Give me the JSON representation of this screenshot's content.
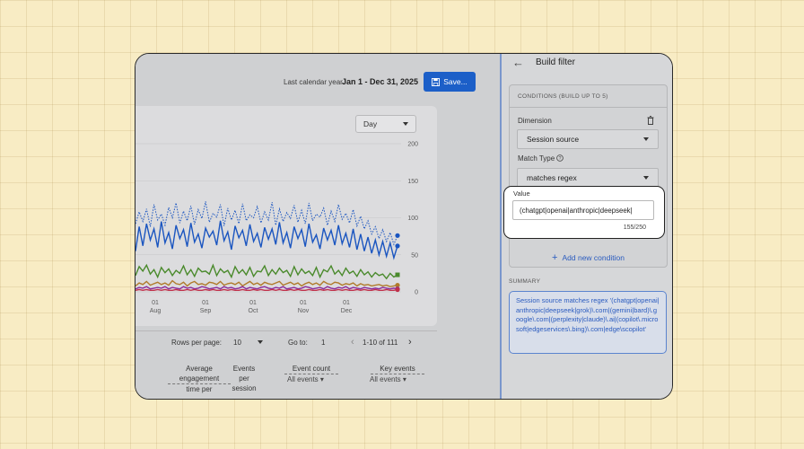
{
  "header": {
    "date_range_label": "Last calendar year",
    "date_range_value": "Jan 1 - Dec 31, 2025",
    "save_label": "Save..."
  },
  "chart_controls": {
    "granularity": "Day"
  },
  "chart_data": {
    "type": "line",
    "x_tick_labels": [
      {
        "line1": "01",
        "line2": "Aug"
      },
      {
        "line1": "01",
        "line2": "Sep"
      },
      {
        "line1": "01",
        "line2": "Oct"
      },
      {
        "line1": "01",
        "line2": "Nov"
      },
      {
        "line1": "01",
        "line2": "Dec"
      }
    ],
    "y_ticks": [
      0,
      50,
      100,
      150,
      200
    ],
    "ylim": [
      0,
      200
    ],
    "series": [
      {
        "color": "#1a55c0",
        "style": "dotted",
        "values": [
          92,
          108,
          95,
          112,
          88,
          118,
          97,
          105,
          90,
          114,
          100,
          120,
          93,
          109,
          96,
          116,
          91,
          111,
          99,
          122,
          94,
          106,
          101,
          118,
          89,
          113,
          97,
          110,
          92,
          119,
          96,
          104,
          100,
          115,
          93,
          108,
          97,
          121,
          90,
          112,
          95,
          107,
          99,
          117,
          94,
          110,
          92,
          120,
          96,
          105,
          101,
          113,
          90,
          109,
          95,
          118,
          98,
          106,
          93,
          111,
          89,
          102,
          85,
          96,
          78,
          88,
          72,
          84,
          68,
          80,
          64,
          76
        ]
      },
      {
        "color": "#1a55c0",
        "style": "solid",
        "values": [
          55,
          88,
          62,
          92,
          70,
          85,
          60,
          95,
          66,
          80,
          58,
          90,
          72,
          84,
          61,
          93,
          67,
          78,
          59,
          86,
          74,
          82,
          63,
          96,
          69,
          81,
          57,
          89,
          73,
          83,
          62,
          91,
          68,
          79,
          60,
          87,
          71,
          85,
          64,
          94,
          66,
          80,
          59,
          88,
          72,
          84,
          61,
          92,
          67,
          77,
          58,
          86,
          70,
          83,
          63,
          90,
          65,
          79,
          60,
          85,
          57,
          78,
          55,
          74,
          52,
          70,
          50,
          68,
          48,
          66,
          46,
          62
        ]
      },
      {
        "color": "#4a8a2c",
        "style": "solid",
        "values": [
          22,
          34,
          28,
          36,
          24,
          30,
          20,
          33,
          26,
          31,
          22,
          29,
          25,
          35,
          23,
          30,
          21,
          32,
          27,
          28,
          24,
          36,
          22,
          31,
          26,
          29,
          20,
          34,
          25,
          30,
          23,
          33,
          21,
          28,
          27,
          35,
          22,
          30,
          24,
          32,
          26,
          29,
          21,
          34,
          23,
          31,
          25,
          28,
          22,
          33,
          20,
          30,
          27,
          35,
          24,
          29,
          22,
          32,
          25,
          28,
          21,
          30,
          23,
          27,
          20,
          26,
          22,
          24,
          18,
          25,
          20,
          23
        ]
      },
      {
        "color": "#b07a2a",
        "style": "solid",
        "values": [
          8,
          12,
          10,
          14,
          9,
          11,
          13,
          10,
          12,
          9,
          15,
          11,
          10,
          13,
          8,
          12,
          14,
          10,
          11,
          9,
          13,
          12,
          10,
          14,
          9,
          11,
          12,
          10,
          13,
          8,
          11,
          14,
          10,
          12,
          9,
          13,
          11,
          10,
          12,
          14,
          9,
          11,
          13,
          10,
          12,
          8,
          11,
          13,
          10,
          12,
          9,
          14,
          11,
          10,
          13,
          12,
          9,
          11,
          10,
          12,
          8,
          11,
          9,
          10,
          8,
          9,
          10,
          8,
          9,
          7,
          8,
          9
        ]
      },
      {
        "color": "#8a2a9a",
        "style": "solid",
        "values": [
          4,
          6,
          5,
          7,
          4,
          5,
          6,
          5,
          7,
          4,
          6,
          5,
          4,
          7,
          5,
          6,
          4,
          5,
          7,
          6,
          4,
          5,
          6,
          4,
          7,
          5,
          6,
          4,
          5,
          7,
          4,
          6,
          5,
          4,
          6,
          7,
          5,
          4,
          6,
          5,
          7,
          4,
          5,
          6,
          4,
          5,
          7,
          6,
          4,
          5,
          6,
          4,
          7,
          5,
          4,
          6,
          5,
          7,
          4,
          6,
          5,
          4,
          6,
          5,
          4,
          5,
          4,
          6,
          5,
          4,
          5,
          4
        ]
      },
      {
        "color": "#c0304a",
        "style": "solid",
        "values": [
          2,
          3,
          2,
          3,
          2,
          2,
          3,
          2,
          3,
          2,
          2,
          3,
          2,
          2,
          3,
          2,
          3,
          2,
          2,
          3,
          2,
          3,
          2,
          2,
          3,
          2,
          3,
          2,
          2,
          3,
          2,
          2,
          3,
          2,
          3,
          2,
          2,
          3,
          2,
          3,
          2,
          2,
          3,
          2,
          3,
          2,
          2,
          3,
          2,
          2,
          3,
          2,
          3,
          2,
          2,
          3,
          2,
          3,
          2,
          2,
          3,
          2,
          3,
          2,
          2,
          3,
          2,
          2,
          3,
          2,
          2,
          3
        ]
      }
    ]
  },
  "table": {
    "rows_per_page_label": "Rows per page:",
    "rows_per_page_value": "10",
    "goto_label": "Go to:",
    "goto_value": "1",
    "range_text": "1-10 of 111",
    "columns": [
      {
        "line1": "Average",
        "line2": "engagement",
        "line3": "time per"
      },
      {
        "line1": "Events",
        "line2": "per",
        "line3": "session"
      },
      {
        "line1": "Event count",
        "filter": "All events"
      },
      {
        "line1": "Key events",
        "filter": "All events"
      }
    ]
  },
  "panel": {
    "title": "Build filter",
    "conditions_header": "CONDITIONS (BUILD UP TO 5)",
    "dimension_label": "Dimension",
    "dimension_value": "Session source",
    "match_type_label": "Match Type",
    "match_type_value": "matches regex",
    "add_condition_label": "Add new condition",
    "summary_label": "SUMMARY",
    "summary_text": "Session source matches regex '(chatgpt|openai|anthropic|deepseek|grok)\\.com|(gemini|bard)\\.google\\.com|(perplexity|claude)\\.ai|(copilot\\.microsoft|edgeservices\\.bing)\\.com|edge\\scopilot'"
  },
  "value_popup": {
    "label": "Value",
    "input_value": "(chatgpt|openai|anthropic|deepseek|",
    "char_count": "155/250"
  },
  "icons": {
    "save": "save-icon",
    "back": "arrow-back-icon",
    "delete": "trash-icon",
    "help": "help-circle-icon",
    "add": "plus-icon"
  }
}
